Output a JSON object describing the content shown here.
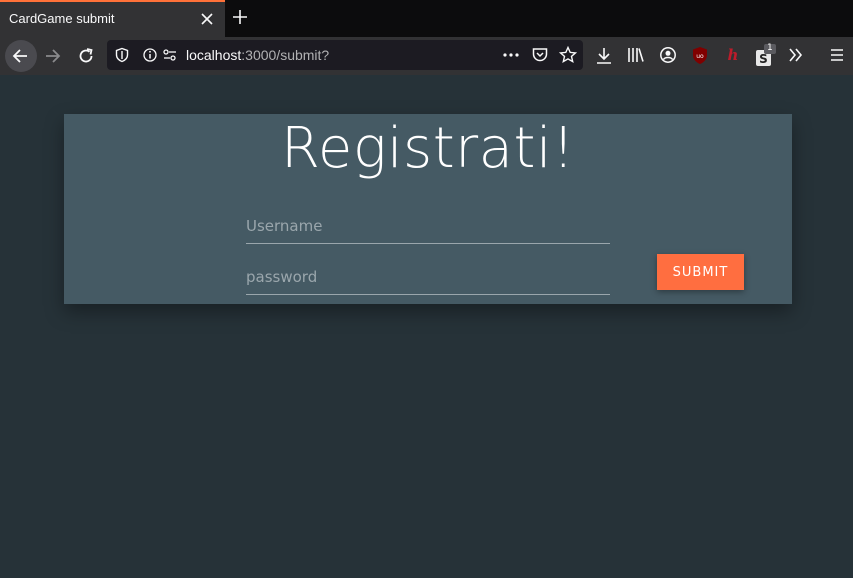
{
  "browser": {
    "tab_title": "CardGame submit",
    "url_host": "localhost",
    "url_rest": ":3000/submit?",
    "ext_badge": "1",
    "accent_color": "#ff7139",
    "icons": [
      "back-icon",
      "forward-icon",
      "reload-icon",
      "shield-icon",
      "info-icon",
      "permissions-icon",
      "more-icon",
      "pocket-icon",
      "bookmark-star-icon",
      "download-icon",
      "library-icon",
      "account-icon",
      "ublock-icon",
      "hypothesis-icon",
      "extension-s-icon",
      "overflow-icon",
      "menu-icon"
    ]
  },
  "page": {
    "title": "Registrati!",
    "username_placeholder": "Username",
    "password_placeholder": "password",
    "submit_label": "SUBMIT",
    "background_color": "#263238",
    "card_color": "#455a64",
    "button_color": "#ff6e40"
  }
}
